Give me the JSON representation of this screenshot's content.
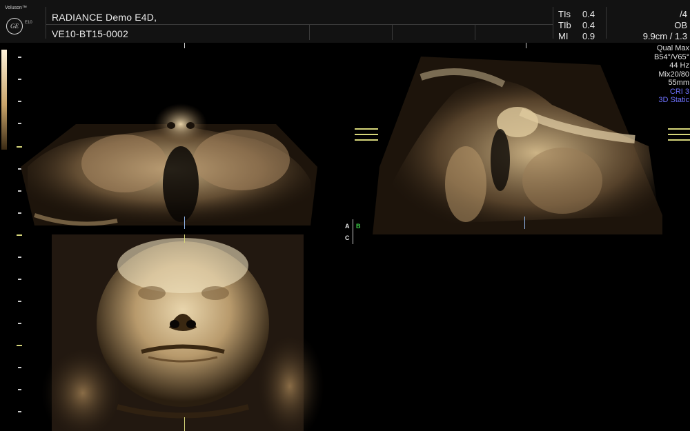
{
  "header": {
    "brand": "Voluson™",
    "logo_letters": "GE",
    "model": "E10",
    "patient_name": "RADIANCE Demo E4D,",
    "patient_id": "VE10-BT15-0002",
    "indices": [
      {
        "label": "TIs",
        "value": "0.4"
      },
      {
        "label": "TIb",
        "value": "0.4"
      },
      {
        "label": "MI",
        "value": "0.9"
      }
    ],
    "frame": "/4",
    "exam": "OB",
    "depth": "9.9cm / 1.3"
  },
  "params": [
    "Qual Max",
    "B54°/V65°",
    "44 Hz",
    "Mix20/80",
    "55mm"
  ],
  "params_blue": [
    "CRI 3",
    "3D Static"
  ],
  "markers": {
    "a": "A",
    "b": "B",
    "c": "C"
  },
  "colors": {
    "b_marker": "#3fd24a",
    "blue_text": "#6f72ff",
    "tissue": "#c8a878"
  },
  "views": [
    {
      "id": "A",
      "icon": "sagittal-fetal-face-image"
    },
    {
      "id": "B",
      "icon": "transverse-fetal-profile-image"
    },
    {
      "id": "C",
      "icon": "rendered-3d-fetal-face-image"
    }
  ]
}
